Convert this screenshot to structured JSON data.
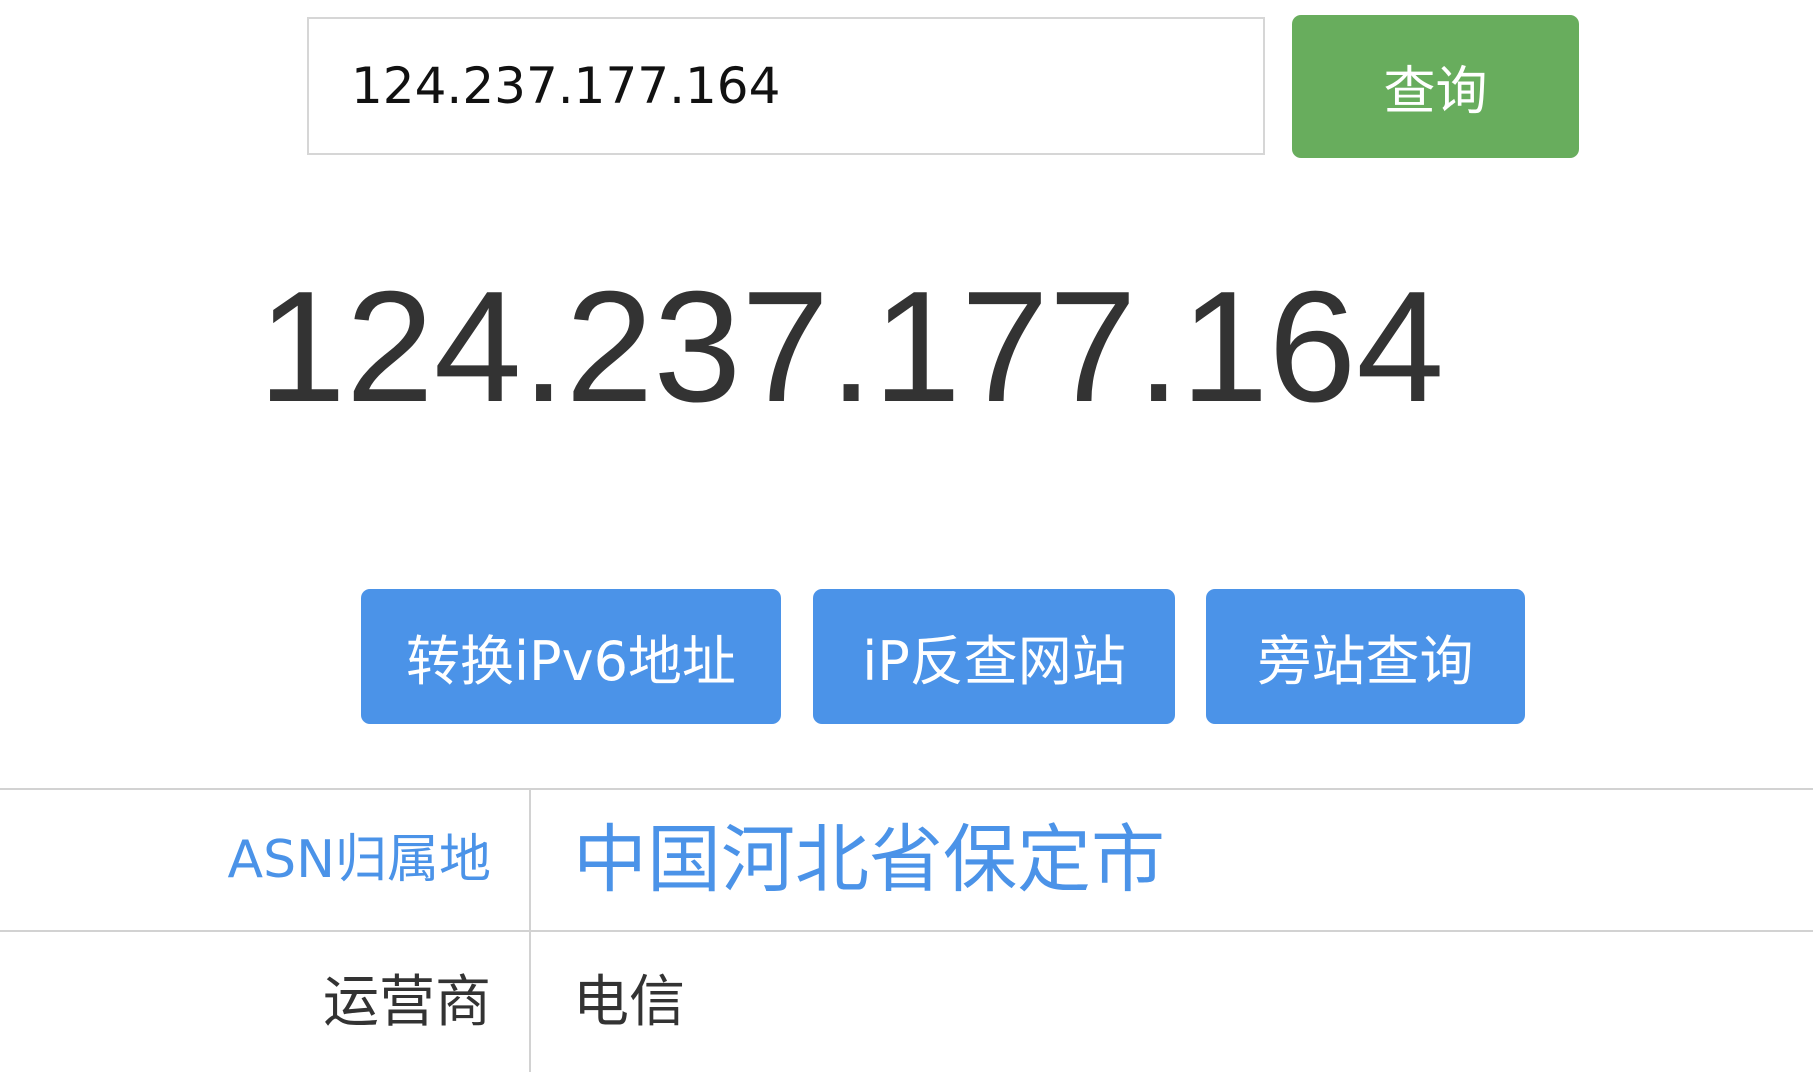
{
  "search": {
    "value": "124.237.177.164",
    "button_label": "查询"
  },
  "result": {
    "ip": "124.237.177.164"
  },
  "actions": [
    {
      "label": "转换iPv6地址"
    },
    {
      "label": "iP反查网站"
    },
    {
      "label": "旁站查询"
    }
  ],
  "info_table": {
    "rows": [
      {
        "label": "ASN归属地",
        "value": "中国河北省保定市"
      },
      {
        "label": "运营商",
        "value": "电信"
      }
    ]
  },
  "colors": {
    "search_button": "#68ad5d",
    "action_button": "#4b93e8",
    "highlight_text": "#4b93e8",
    "body_text": "#333333",
    "border": "#d2d2d2"
  }
}
